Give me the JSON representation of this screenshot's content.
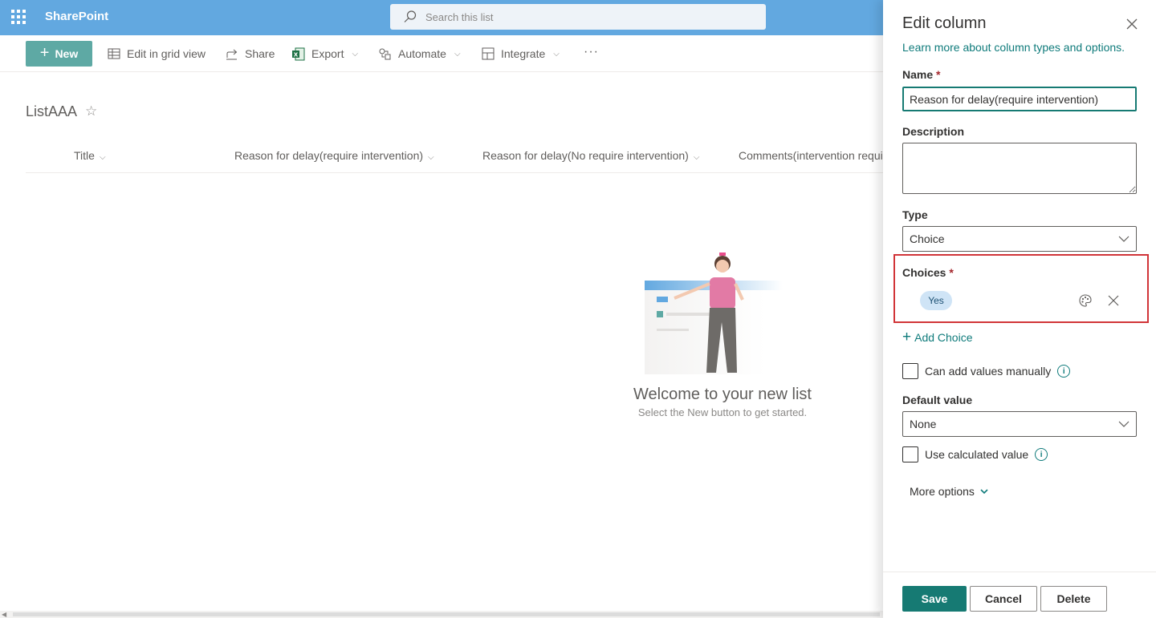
{
  "suitebar": {
    "app_name": "SharePoint",
    "search_placeholder": "Search this list",
    "color": "#62a8e0"
  },
  "commandbar": {
    "new_label": "New",
    "edit_grid_label": "Edit in grid view",
    "share_label": "Share",
    "export_label": "Export",
    "automate_label": "Automate",
    "integrate_label": "Integrate",
    "more_label": "···"
  },
  "list": {
    "title": "ListAAA",
    "columns": [
      "Title",
      "Reason for delay(require intervention)",
      "Reason for delay(No require intervention)",
      "Comments(intervention required)"
    ],
    "empty_title": "Welcome to your new list",
    "empty_subtitle": "Select the New button to get started."
  },
  "panel": {
    "title": "Edit column",
    "learn_link": "Learn more about column types and options.",
    "name_label": "Name",
    "name_value": "Reason for delay(require intervention)",
    "description_label": "Description",
    "description_value": "",
    "type_label": "Type",
    "type_value": "Choice",
    "choices_label": "Choices",
    "choices": [
      "Yes"
    ],
    "add_choice_label": "Add Choice",
    "can_add_manually_label": "Can add values manually",
    "default_value_label": "Default value",
    "default_value": "None",
    "use_calculated_label": "Use calculated value",
    "more_options_label": "More options",
    "save_label": "Save",
    "cancel_label": "Cancel",
    "delete_label": "Delete",
    "accent": "#167a73",
    "highlight_color": "#d13438"
  }
}
